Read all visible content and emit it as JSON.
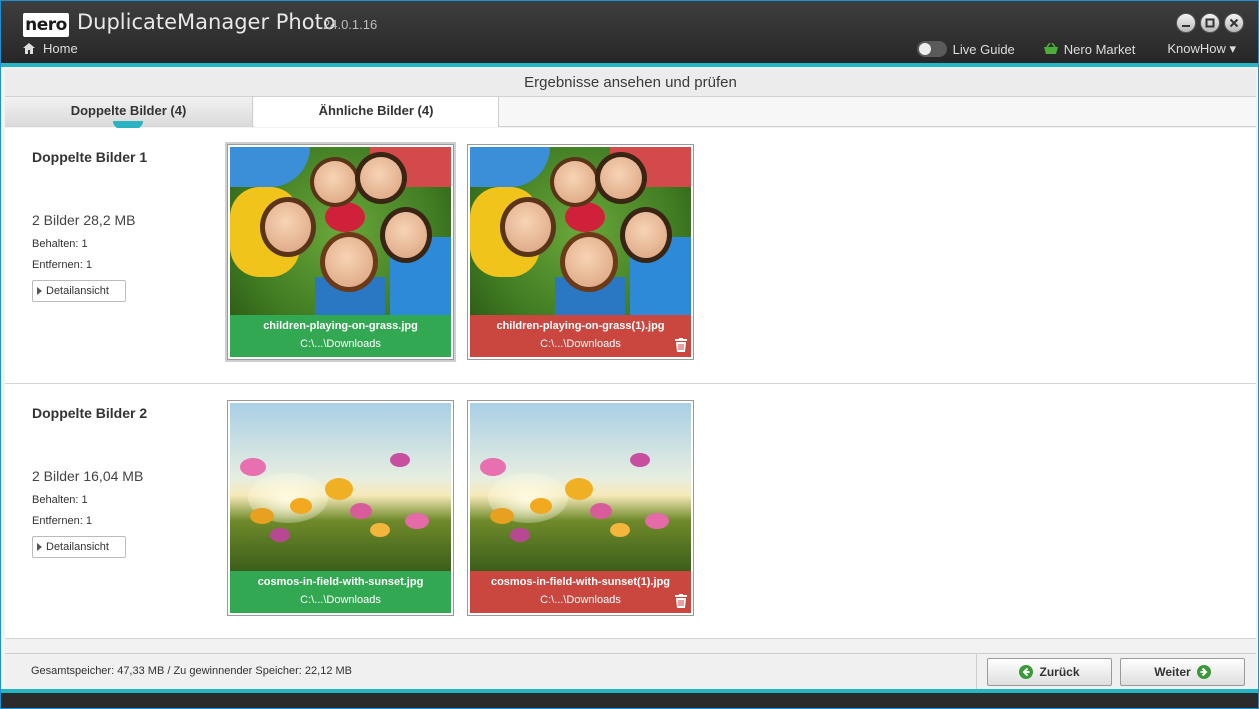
{
  "app": {
    "logo": "nero",
    "title": "DuplicateManager Photo",
    "version": "24.0.1.16",
    "home_label": "Home"
  },
  "topbar": {
    "live_guide": "Live Guide",
    "nero_market": "Nero Market",
    "knowhow": "KnowHow ▾"
  },
  "header": {
    "title": "Ergebnisse ansehen und prüfen"
  },
  "tabs": [
    {
      "label": "Doppelte Bilder (4)",
      "active": true
    },
    {
      "label": "Ähnliche Bilder (4)",
      "active": false
    }
  ],
  "groups": [
    {
      "title": "Doppelte Bilder 1",
      "count": "2 Bilder  28,2 MB",
      "keep": "Behalten: 1",
      "remove": "Entfernen: 1",
      "detail_label": "Detailansicht",
      "images": [
        {
          "name": "children-playing-on-grass.jpg",
          "path": "C:\\...\\Downloads",
          "status": "keep"
        },
        {
          "name": "children-playing-on-grass(1).jpg",
          "path": "C:\\...\\Downloads",
          "status": "remove"
        }
      ]
    },
    {
      "title": "Doppelte Bilder 2",
      "count": "2 Bilder  16,04 MB",
      "keep": "Behalten: 1",
      "remove": "Entfernen: 1",
      "detail_label": "Detailansicht",
      "images": [
        {
          "name": "cosmos-in-field-with-sunset.jpg",
          "path": "C:\\...\\Downloads",
          "status": "keep"
        },
        {
          "name": "cosmos-in-field-with-sunset(1).jpg",
          "path": "C:\\...\\Downloads",
          "status": "remove"
        }
      ]
    }
  ],
  "footer": {
    "info": "Gesamtspeicher: 47,33 MB / Zu gewinnender Speicher: 22,12 MB",
    "back_label": "Zurück",
    "next_label": "Weiter"
  },
  "colors": {
    "accent": "#23b6c4",
    "keep": "#33a852",
    "remove": "#c9473f"
  },
  "icons": [
    "home-icon",
    "minimize-icon",
    "maximize-icon",
    "close-icon",
    "basket-icon",
    "trash-icon",
    "arrow-left-icon",
    "arrow-right-icon",
    "triangle-right-icon"
  ]
}
